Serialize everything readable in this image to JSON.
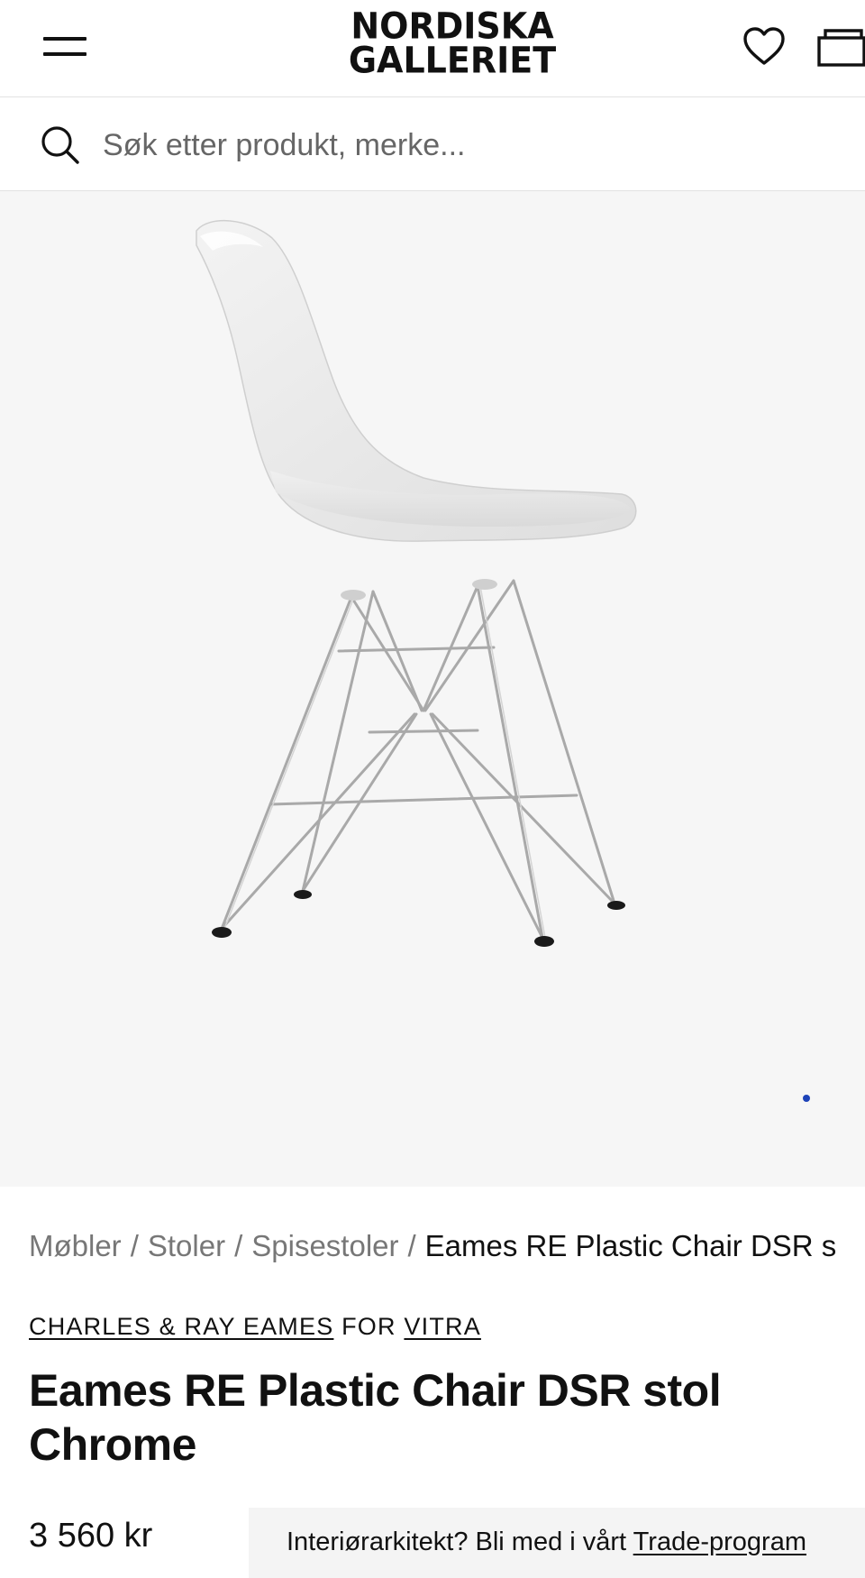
{
  "header": {
    "logo_line1": "NORDISKA",
    "logo_line2": "GALLERIET",
    "menu_icon": "hamburger-menu-icon",
    "wishlist_icon": "heart-icon",
    "cart_icon": "shopping-bag-icon"
  },
  "search": {
    "placeholder": "Søk etter produkt, merke...",
    "icon": "search-icon"
  },
  "gallery": {
    "image_subject": "white plastic side chair on chrome wire base",
    "dot_color": "#1d43b8",
    "background_color": "#f6f6f6"
  },
  "breadcrumb": {
    "items": [
      "Møbler",
      "Stoler",
      "Spisestoler"
    ],
    "separator": "/",
    "current": "Eames RE Plastic Chair DSR s"
  },
  "product": {
    "designer": "CHARLES & RAY EAMES",
    "for_label": "FOR",
    "brand": "VITRA",
    "title": "Eames RE Plastic Chair DSR stol Chrome",
    "price": "3 560 kr"
  },
  "trade_banner": {
    "text": "Interiørarkitekt? Bli med i vårt",
    "link": "Trade-program"
  }
}
